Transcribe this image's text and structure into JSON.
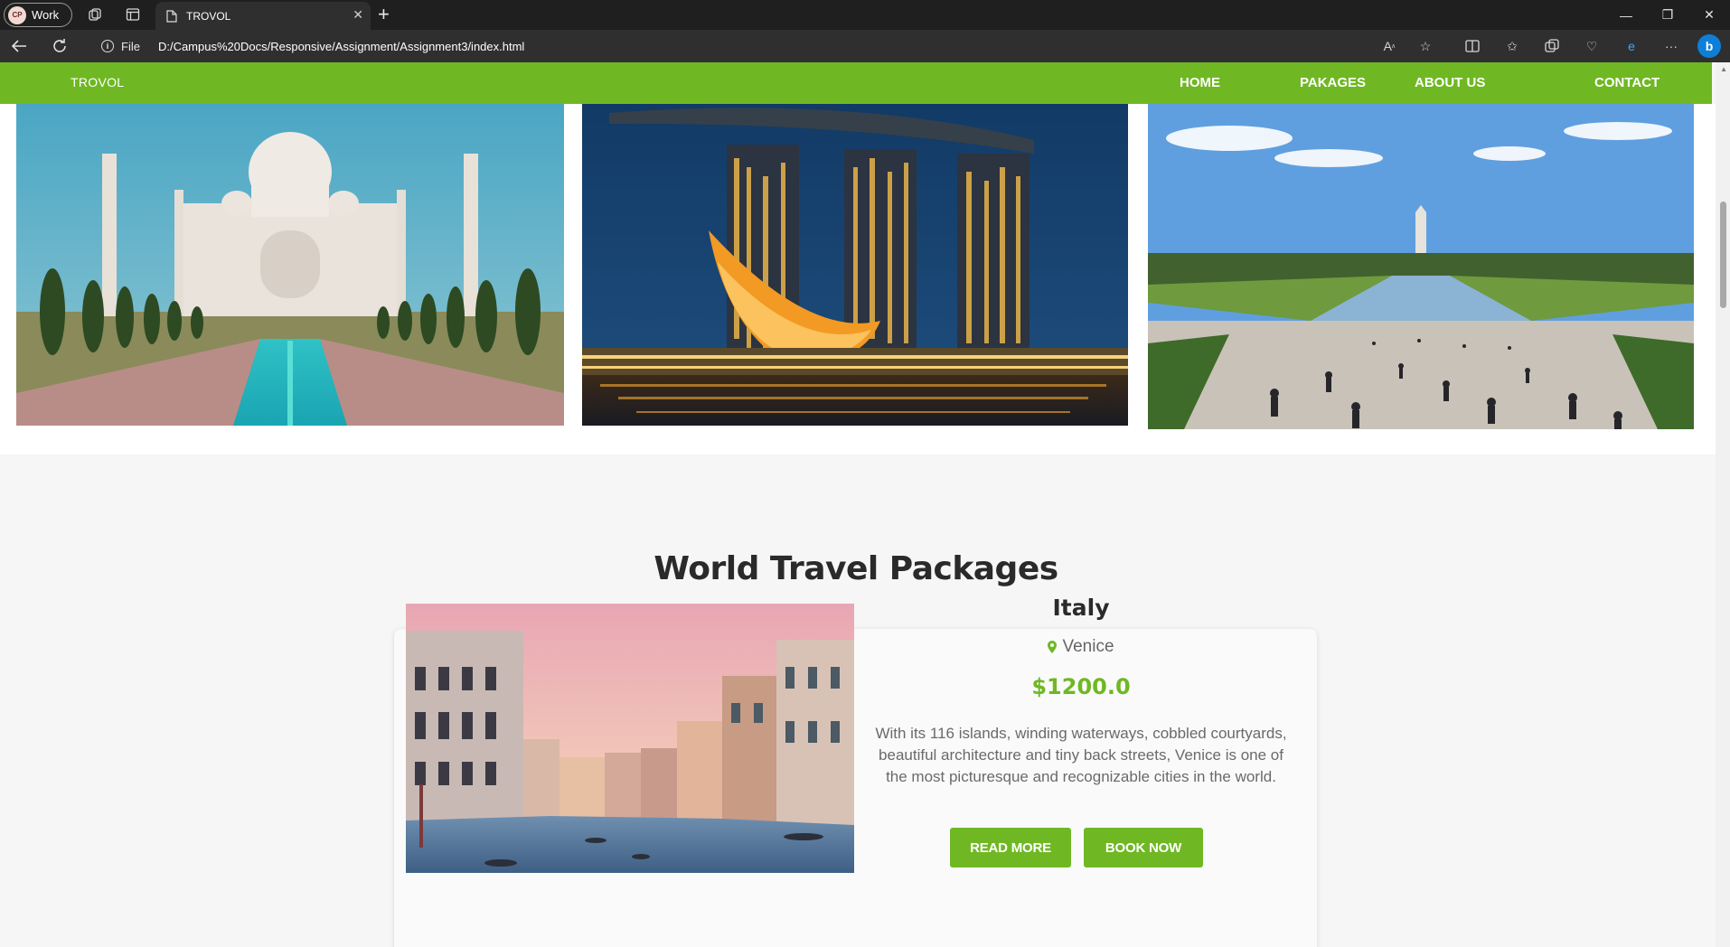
{
  "browser": {
    "profile_name": "Work",
    "profile_initials": "CP",
    "tab_title": "TROVOL",
    "address_prefix": "File",
    "url": "D:/Campus%20Docs/Responsive/Assignment/Assignment3/index.html"
  },
  "site": {
    "brand": "TROVOL",
    "nav": [
      "HOME",
      "PAKAGES",
      "ABOUT US",
      "CONTACT"
    ],
    "accent_color": "#6fb823"
  },
  "gallery": [
    {
      "subject": "Taj Mahal with reflecting pool"
    },
    {
      "subject": "Marina Bay Sands and ArtScience Museum at night"
    },
    {
      "subject": "National Mall with Washington Monument"
    }
  ],
  "packages": {
    "title": "World Travel Packages",
    "items": [
      {
        "name": "Italy",
        "location": "Venice",
        "price": "$1200.0",
        "description": "With its 116 islands, winding waterways, cobbled courtyards, beautiful architecture and tiny back streets, Venice is one of the most picturesque and recognizable cities in the world.",
        "read_more": "READ MORE",
        "book_now": "BOOK NOW"
      }
    ]
  }
}
